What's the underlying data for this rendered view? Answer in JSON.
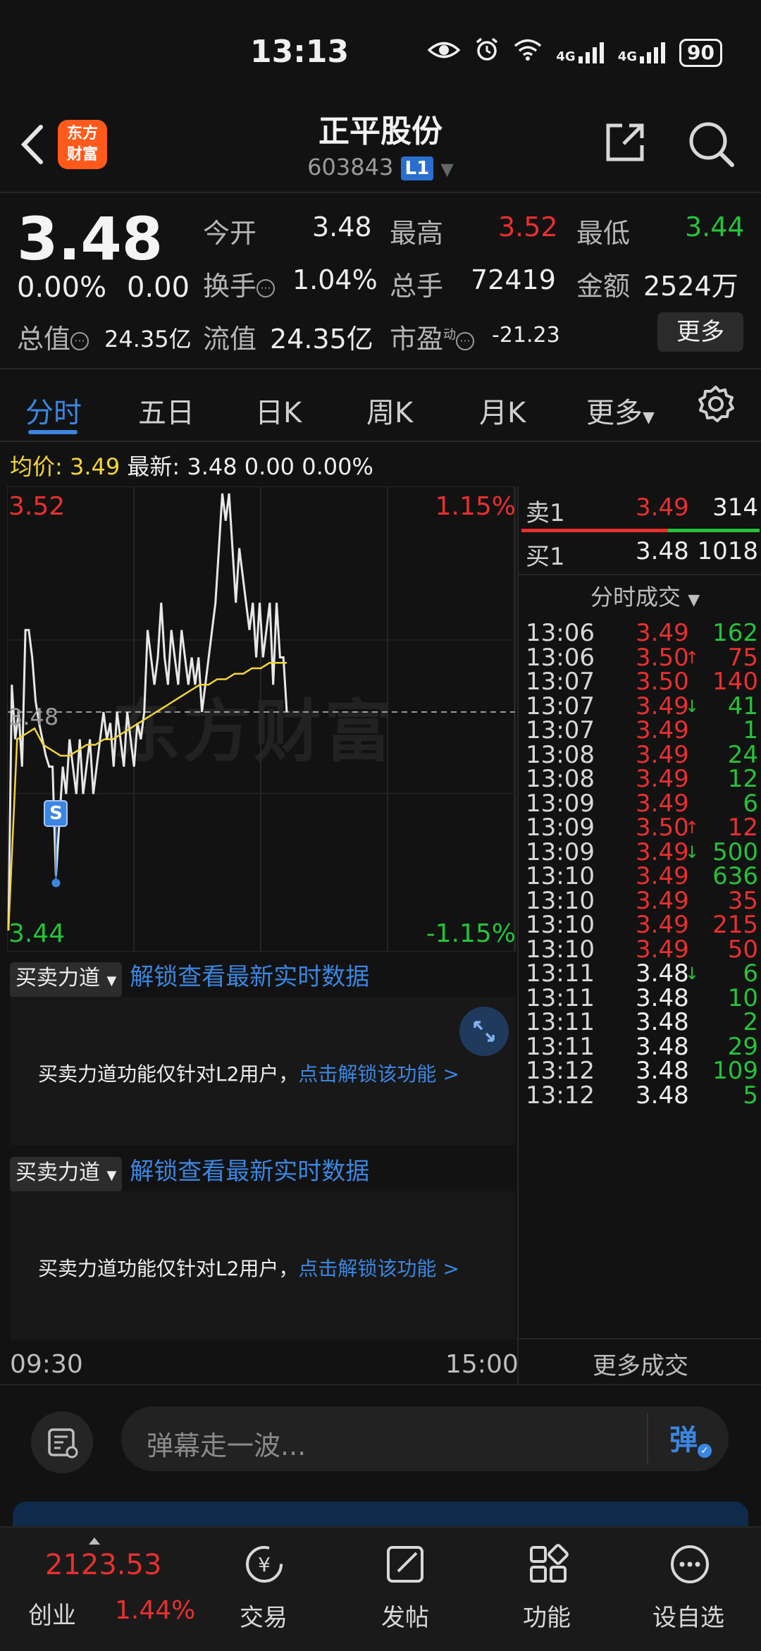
{
  "status_bar": {
    "time": "13:13",
    "battery": "90",
    "signal_1": "4G",
    "signal_2": "4G"
  },
  "header": {
    "stock_name": "正平股份",
    "stock_code": "603843",
    "level_badge": "L1",
    "logo_line1": "东方",
    "logo_line2": "财富"
  },
  "quote": {
    "price": "3.48",
    "change_pct": "0.00%",
    "change_abs": "0.00",
    "open_label": "今开",
    "open": "3.48",
    "high_label": "最高",
    "high": "3.52",
    "low_label": "最低",
    "low": "3.44",
    "turnover_label": "换手",
    "turnover": "1.04%",
    "volume_label": "总手",
    "volume": "72419",
    "amount_label": "金额",
    "amount": "2524万",
    "total_cap_label": "总值",
    "total_cap": "24.35亿",
    "float_cap_label": "流值",
    "float_cap": "24.35亿",
    "pe_label": "市盈",
    "pe_sup": "动",
    "pe": "-21.23",
    "more_button": "更多"
  },
  "tabs": [
    "分时",
    "五日",
    "日K",
    "周K",
    "月K",
    "更多"
  ],
  "avg_row": {
    "avg_label": "均价:",
    "avg_value": "3.49",
    "latest_label": "最新:",
    "latest_price": "3.48",
    "latest_change": "0.00",
    "latest_pct": "0.00%"
  },
  "chart_data": {
    "type": "line",
    "title": "",
    "ylim": [
      3.44,
      3.52
    ],
    "y_top_label": "3.52",
    "y_bottom_label": "3.44",
    "y_mid_label": "3.48",
    "pct_top_label": "1.15%",
    "pct_bottom_label": "-1.15%",
    "x_start_label": "09:30",
    "x_end_label": "15:00",
    "marker_label": "S",
    "series": [
      {
        "values": [
          3.44,
          3.485,
          3.475,
          3.48,
          3.47,
          3.495,
          3.495,
          3.49,
          3.482,
          3.478,
          3.475,
          3.472,
          3.47,
          3.47,
          3.45,
          3.46,
          3.47,
          3.465,
          3.475,
          3.47,
          3.465,
          3.475,
          3.465,
          3.47,
          3.475,
          3.465,
          3.47,
          3.475,
          3.48,
          3.475,
          3.478,
          3.47,
          3.48,
          3.475,
          3.47,
          3.48,
          3.475,
          3.47,
          3.478,
          3.475,
          3.48,
          3.495,
          3.49,
          3.485,
          3.49,
          3.5,
          3.49,
          3.485,
          3.495,
          3.49,
          3.485,
          3.495,
          3.49,
          3.485,
          3.49,
          3.485,
          3.49,
          3.48,
          3.485,
          3.49,
          3.495,
          3.5,
          3.51,
          3.52,
          3.515,
          3.52,
          3.51,
          3.5,
          3.51,
          3.505,
          3.5,
          3.495,
          3.5,
          3.49,
          3.5,
          3.49,
          3.495,
          3.5,
          3.485,
          3.5,
          3.49,
          3.49,
          3.48
        ]
      },
      {
        "values": [
          3.44,
          3.475,
          3.476,
          3.477,
          3.474,
          3.473,
          3.472,
          3.472,
          3.473,
          3.474,
          3.474,
          3.475,
          3.475,
          3.476,
          3.477,
          3.478,
          3.479,
          3.48,
          3.481,
          3.482,
          3.483,
          3.484,
          3.485,
          3.485,
          3.486,
          3.486,
          3.487,
          3.487,
          3.488,
          3.488,
          3.489,
          3.489,
          3.489
        ]
      }
    ],
    "watermark": "东方财富"
  },
  "order_book": {
    "sell1_label": "卖1",
    "sell1_price": "3.49",
    "sell1_vol": "314",
    "buy1_label": "买1",
    "buy1_price": "3.48",
    "buy1_vol": "1018"
  },
  "trades": {
    "title": "分时成交",
    "rows": [
      {
        "t": "13:06",
        "p": "3.49",
        "a": "",
        "v": "162",
        "pc": "red",
        "vc": "green"
      },
      {
        "t": "13:06",
        "p": "3.50",
        "a": "↑",
        "v": "75",
        "pc": "red",
        "vc": "red"
      },
      {
        "t": "13:07",
        "p": "3.50",
        "a": "",
        "v": "140",
        "pc": "red",
        "vc": "red"
      },
      {
        "t": "13:07",
        "p": "3.49",
        "a": "↓",
        "v": "41",
        "pc": "red",
        "vc": "green"
      },
      {
        "t": "13:07",
        "p": "3.49",
        "a": "",
        "v": "1",
        "pc": "red",
        "vc": "green"
      },
      {
        "t": "13:08",
        "p": "3.49",
        "a": "",
        "v": "24",
        "pc": "red",
        "vc": "green"
      },
      {
        "t": "13:08",
        "p": "3.49",
        "a": "",
        "v": "12",
        "pc": "red",
        "vc": "green"
      },
      {
        "t": "13:09",
        "p": "3.49",
        "a": "",
        "v": "6",
        "pc": "red",
        "vc": "green"
      },
      {
        "t": "13:09",
        "p": "3.50",
        "a": "↑",
        "v": "12",
        "pc": "red",
        "vc": "red"
      },
      {
        "t": "13:09",
        "p": "3.49",
        "a": "↓",
        "v": "500",
        "pc": "red",
        "vc": "green"
      },
      {
        "t": "13:10",
        "p": "3.49",
        "a": "",
        "v": "636",
        "pc": "red",
        "vc": "green"
      },
      {
        "t": "13:10",
        "p": "3.49",
        "a": "",
        "v": "35",
        "pc": "red",
        "vc": "red"
      },
      {
        "t": "13:10",
        "p": "3.49",
        "a": "",
        "v": "215",
        "pc": "red",
        "vc": "red"
      },
      {
        "t": "13:10",
        "p": "3.49",
        "a": "",
        "v": "50",
        "pc": "red",
        "vc": "red"
      },
      {
        "t": "13:11",
        "p": "3.48",
        "a": "↓",
        "v": "6",
        "pc": "white",
        "vc": "green"
      },
      {
        "t": "13:11",
        "p": "3.48",
        "a": "",
        "v": "10",
        "pc": "white",
        "vc": "green"
      },
      {
        "t": "13:11",
        "p": "3.48",
        "a": "",
        "v": "2",
        "pc": "white",
        "vc": "green"
      },
      {
        "t": "13:11",
        "p": "3.48",
        "a": "",
        "v": "29",
        "pc": "white",
        "vc": "green"
      },
      {
        "t": "13:12",
        "p": "3.48",
        "a": "",
        "v": "109",
        "pc": "white",
        "vc": "green"
      },
      {
        "t": "13:12",
        "p": "3.48",
        "a": "",
        "v": "5",
        "pc": "white",
        "vc": "green"
      }
    ],
    "more_label": "更多成交"
  },
  "panels": {
    "tag": "买卖力道",
    "unlock_link": "解锁查看最新实时数据",
    "msg": "买卖力道功能仅针对L2用户，",
    "msg_link": "点击解锁该功能 >"
  },
  "danmaku": {
    "placeholder": "弹幕走一波...",
    "send_label": "弹"
  },
  "bottom_nav": {
    "index_value": "2123.53",
    "index_name": "创业",
    "index_pct": "1.44%",
    "trade": "交易",
    "post": "发帖",
    "func": "功能",
    "watchlist": "设自选"
  },
  "colors": {
    "up": "#e8302f",
    "down": "#25c23a",
    "accent": "#3b86e0",
    "avg_line": "#f3d43a",
    "bg": "#121212"
  }
}
